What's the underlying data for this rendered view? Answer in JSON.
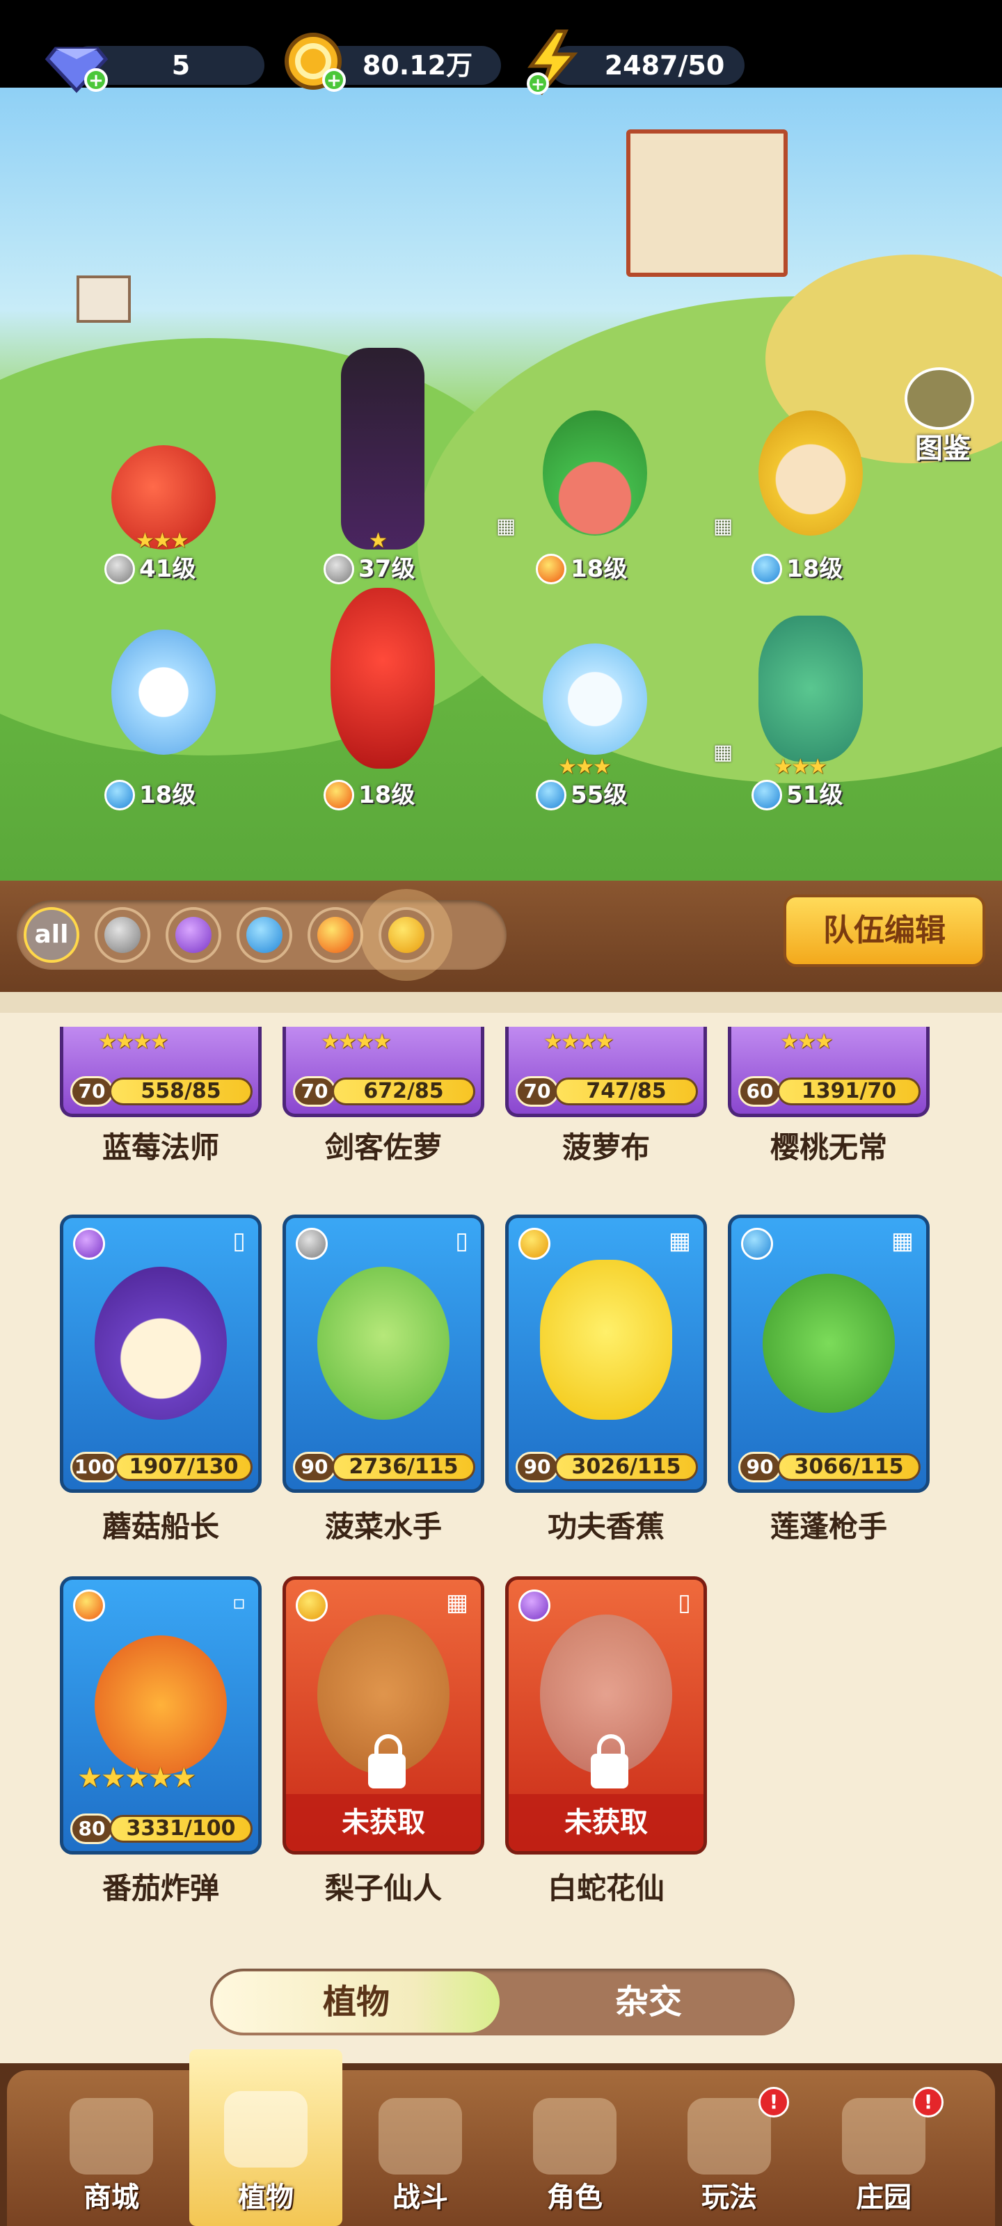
{
  "currency": {
    "gems": "5",
    "gold": "80.12万",
    "energy": "2487/50"
  },
  "codex_label": "图鉴",
  "team_heroes": [
    {
      "level": "41级",
      "element": "sword",
      "stars": "★★★"
    },
    {
      "level": "37级",
      "element": "sword",
      "stars": "★"
    },
    {
      "level": "18级",
      "element": "fire",
      "stars": ""
    },
    {
      "level": "18级",
      "element": "water",
      "stars": ""
    },
    {
      "level": "18级",
      "element": "water",
      "stars": ""
    },
    {
      "level": "18级",
      "element": "fire",
      "stars": ""
    },
    {
      "level": "55级",
      "element": "water",
      "stars": "★★★"
    },
    {
      "level": "51级",
      "element": "water",
      "stars": "★★★"
    }
  ],
  "filters": {
    "all_label": "all",
    "items": [
      "sword-icon",
      "potion-icon",
      "water-drop-icon",
      "fire-icon",
      "lightning-icon"
    ]
  },
  "team_edit_label": "队伍编辑",
  "cards_row1": [
    {
      "name": "蓝莓法师",
      "level": "70",
      "progress": "558/85",
      "stars": "★★★★"
    },
    {
      "name": "剑客佐萝",
      "level": "70",
      "progress": "672/85",
      "stars": "★★★★"
    },
    {
      "name": "菠萝布",
      "level": "70",
      "progress": "747/85",
      "stars": "★★★★"
    },
    {
      "name": "樱桃无常",
      "level": "60",
      "progress": "1391/70",
      "stars": "★★★"
    }
  ],
  "cards_row2": [
    {
      "name": "蘑菇船长",
      "level": "100",
      "progress": "1907/130",
      "element": "potion"
    },
    {
      "name": "菠菜水手",
      "level": "90",
      "progress": "2736/115",
      "element": "sword"
    },
    {
      "name": "功夫香蕉",
      "level": "90",
      "progress": "3026/115",
      "element": "bolt"
    },
    {
      "name": "莲蓬枪手",
      "level": "90",
      "progress": "3066/115",
      "element": "water"
    }
  ],
  "cards_row3": [
    {
      "name": "番茄炸弹",
      "level": "80",
      "progress": "3331/100",
      "stars": "★★★★★",
      "element": "fire"
    },
    {
      "name": "梨子仙人",
      "locked_label": "未获取",
      "element": "bolt"
    },
    {
      "name": "白蛇花仙",
      "locked_label": "未获取",
      "element": "potion"
    }
  ],
  "toggle": {
    "active": "植物",
    "inactive": "杂交"
  },
  "nav": [
    {
      "label": "商城",
      "badge": ""
    },
    {
      "label": "植物",
      "badge": ""
    },
    {
      "label": "战斗",
      "badge": ""
    },
    {
      "label": "角色",
      "badge": ""
    },
    {
      "label": "玩法",
      "badge": "!"
    },
    {
      "label": "庄园",
      "badge": "!"
    }
  ]
}
